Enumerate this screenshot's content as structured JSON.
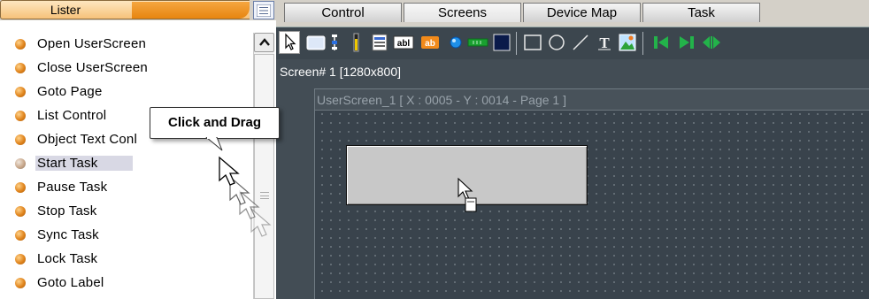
{
  "lister": {
    "tab_label": "Lister",
    "menu_icon": "list-menu-icon",
    "items": [
      {
        "label": "Open UserScreen",
        "icon": "action-dot-icon",
        "selected": false
      },
      {
        "label": "Close UserScreen",
        "icon": "action-dot-icon",
        "selected": false
      },
      {
        "label": "Goto Page",
        "icon": "action-dot-icon",
        "selected": false
      },
      {
        "label": "List Control",
        "icon": "action-dot-icon",
        "selected": false
      },
      {
        "label": "Object Text Conl",
        "icon": "action-dot-icon",
        "selected": false
      },
      {
        "label": "Start Task",
        "icon": "action-dot-icon",
        "selected": true
      },
      {
        "label": "Pause Task",
        "icon": "action-dot-icon",
        "selected": false
      },
      {
        "label": "Stop Task",
        "icon": "action-dot-icon",
        "selected": false
      },
      {
        "label": "Sync Task",
        "icon": "action-dot-icon",
        "selected": false
      },
      {
        "label": "Lock Task",
        "icon": "action-dot-icon",
        "selected": false
      },
      {
        "label": "Goto Label",
        "icon": "action-dot-icon",
        "selected": false
      }
    ]
  },
  "tabs": [
    {
      "label": "Control",
      "active": false
    },
    {
      "label": "Screens",
      "active": true
    },
    {
      "label": "Device Map",
      "active": false
    },
    {
      "label": "Task",
      "active": false
    }
  ],
  "toolbar": {
    "tools": [
      "pointer-arrow-icon",
      "button-object-icon",
      "slider-icon",
      "level-bar-icon",
      "list-icon",
      "text-box-icon",
      "label-icon",
      "led-icon",
      "progress-bar-icon",
      "color-box-icon",
      "rectangle-icon",
      "ellipse-icon",
      "line-icon",
      "text-tool-icon",
      "image-icon",
      "first-page-icon",
      "last-page-icon",
      "toggle-pages-icon"
    ]
  },
  "canvas": {
    "screen_label": "Screen# 1 [1280x800]",
    "userscreen_title": "UserScreen_1 [ X : 0005 - Y : 0014 - Page 1 ]"
  },
  "callout": {
    "text": "Click and Drag"
  },
  "colors": {
    "lister_accent": "#f39a2a",
    "editor_background": "#434d55",
    "dropped_button": "#c8c8c8"
  }
}
